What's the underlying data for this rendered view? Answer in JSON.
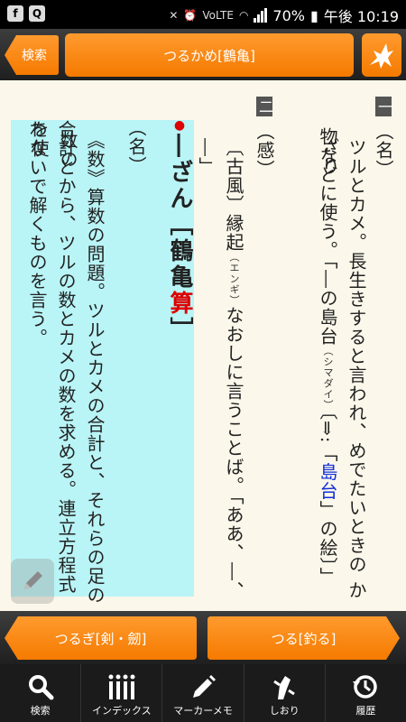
{
  "status_bar": {
    "signal": "70%",
    "time": "午後 10:19",
    "lte": "VoLTE"
  },
  "header": {
    "search_label": "検索",
    "title": "つるかめ[鶴亀]"
  },
  "entry": {
    "sense1_marker": "一",
    "sense1_pos": "（名）",
    "sense1_line1": "ツルとカメ。長生きすると言われ、めでたいときの かざり",
    "sense1_line2a": "物などに使う。「―の島台",
    "sense1_ruby1": "（シマダイ）",
    "sense1_line2b": "〔⇒:「",
    "sense1_link": "島台",
    "sense1_line2c": "」の絵〕」",
    "sense2_marker": "二",
    "sense2_pos": "（感）",
    "sense2_text_a": "〔古風〕縁起",
    "sense2_ruby": "（エンギ）",
    "sense2_text_b": "なおしに言うことば。「ああ、―、―」",
    "sub_dot": "●",
    "sub_headword_a": "―ざん",
    "sub_headword_b": "［鶴亀",
    "sub_headword_red": "算",
    "sub_headword_c": "］",
    "sub_pos": "（名）",
    "sub_line1": "《数》算数の問題。ツルとカメの合計と、それらの足の数の",
    "sub_line2": "合計とから、ツルの数とカメの数を求める。連立方程式を使",
    "sub_line3": "わないで解くものを言う。"
  },
  "nav": {
    "prev_label": "つるぎ[剣・劒]",
    "next_label": "つる[釣る]"
  },
  "tabs": [
    {
      "label": "検索",
      "icon": "search-icon"
    },
    {
      "label": "インデックス",
      "icon": "index-icon"
    },
    {
      "label": "マーカーメモ",
      "icon": "marker-pen-icon"
    },
    {
      "label": "しおり",
      "icon": "bookmark-icon"
    },
    {
      "label": "履歴",
      "icon": "history-icon"
    }
  ],
  "colors": {
    "accent": "#f57a00",
    "highlight": "#b9f4f6",
    "link": "#1330d8"
  }
}
